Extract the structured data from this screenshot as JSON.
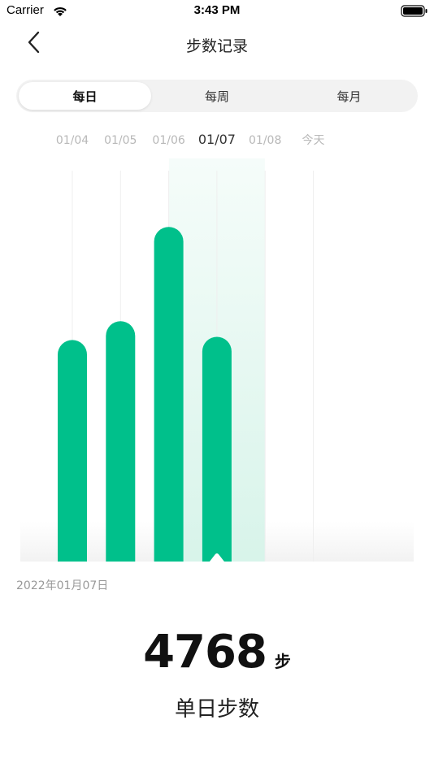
{
  "status_bar": {
    "carrier": "Carrier",
    "time": "3:43 PM"
  },
  "nav": {
    "title": "步数记录"
  },
  "tabs": [
    {
      "label": "每日",
      "active": true
    },
    {
      "label": "每周",
      "active": false
    },
    {
      "label": "每月",
      "active": false
    }
  ],
  "chart_data": {
    "type": "bar",
    "categories": [
      "01/04",
      "01/05",
      "01/06",
      "01/07",
      "01/08",
      "今天"
    ],
    "values": [
      4700,
      5100,
      7100,
      4768,
      0,
      0
    ],
    "selected": "01/07",
    "ylim": [
      0,
      8500
    ]
  },
  "colors": {
    "bar": "#00c08b",
    "highlight": "#d8f4ea",
    "label_inactive": "#b8b8b8",
    "label_active": "#333333"
  },
  "detail": {
    "date": "2022年01月07日",
    "steps_value": "4768",
    "steps_unit": "步",
    "steps_label": "单日步数"
  }
}
